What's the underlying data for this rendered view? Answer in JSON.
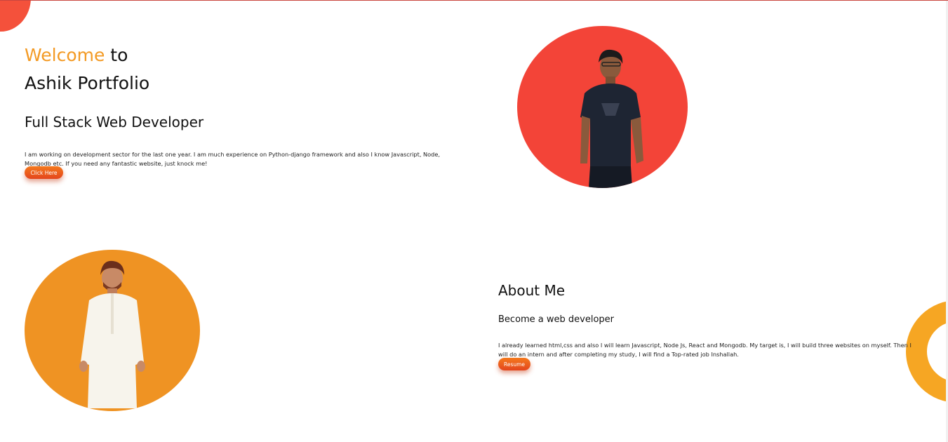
{
  "hero": {
    "welcome_word": "Welcome",
    "to_word": " to",
    "name_line": "Ashik Portfolio",
    "subtitle": "Full Stack Web Developer",
    "description": "I am working on development sector for the last one year. I am much experience on Python-django framework and also I know Javascript, Node, Mongodb etc. If you need any fantastic website, just knock me!",
    "button_label": "Click Here"
  },
  "about": {
    "title": "About Me",
    "subtitle": "Become a web developer",
    "description": "I already learned html,css and also I will learn Javascript, Node Js, React and Mongodb. My target is, I will build three websites on myself. Then I will do an intern and after completing my study, I will find a Top-rated job Inshallah.",
    "button_label": "Resume"
  },
  "colors": {
    "accent_orange": "#f39a24",
    "circle_red": "#f34438",
    "circle_orange": "#ef9323",
    "button_gradient_top": "#f4791d",
    "button_gradient_bottom": "#e4451d"
  },
  "icons": {
    "photo_1": "portrait-dark-tshirt",
    "photo_2": "portrait-white-kurta"
  }
}
